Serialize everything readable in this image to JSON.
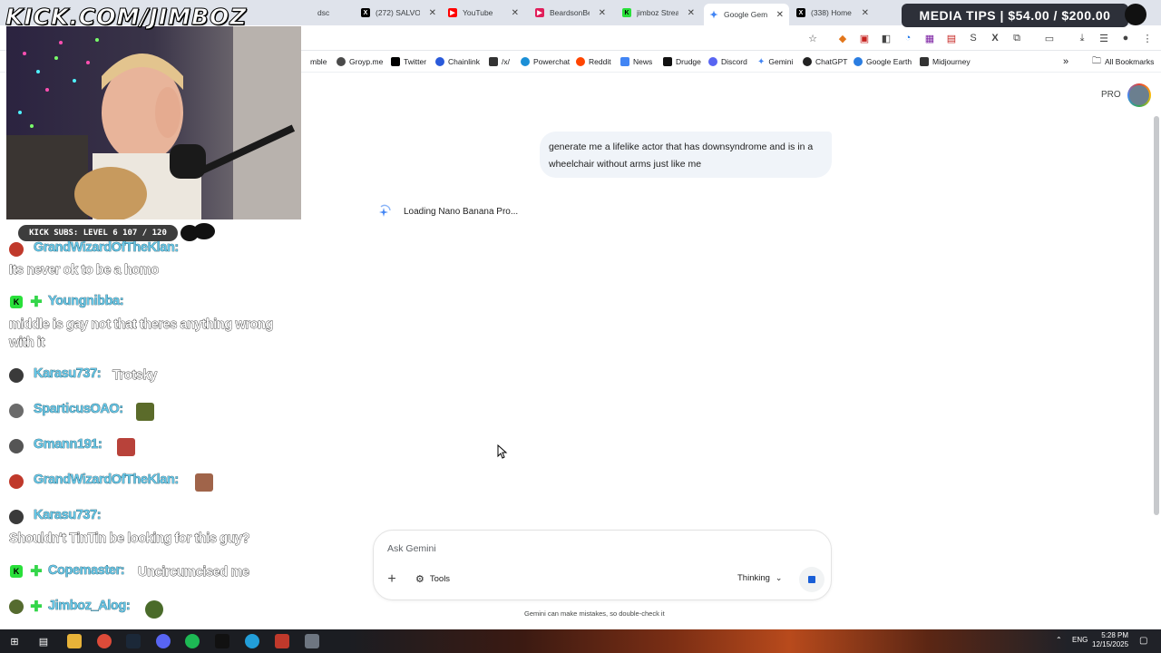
{
  "browser": {
    "tabs": [
      {
        "label": "dsc",
        "color": "#7b6a5a",
        "active": false
      },
      {
        "label": "(272) SALVO",
        "color": "#000000",
        "active": false
      },
      {
        "label": "YouTube",
        "color": "#ff0000",
        "active": false
      },
      {
        "label": "BeardsonBea",
        "color": "#e01e5a",
        "active": false
      },
      {
        "label": "jimboz Stream",
        "color": "#29e03a",
        "active": false
      },
      {
        "label": "Google Gemi",
        "color": "#4285f4",
        "active": true
      },
      {
        "label": "(338) Home",
        "color": "#000000",
        "active": false
      }
    ],
    "bookmarks": [
      {
        "label": "mble",
        "color": "#555555"
      },
      {
        "label": "Groyp.me",
        "color": "#4a4a4a"
      },
      {
        "label": "Twitter",
        "color": "#000000"
      },
      {
        "label": "Chainlink",
        "color": "#2a5ada"
      },
      {
        "label": "/x/",
        "color": "#333333"
      },
      {
        "label": "Powerchat",
        "color": "#1b8fd6"
      },
      {
        "label": "Reddit",
        "color": "#ff4500"
      },
      {
        "label": "News",
        "color": "#4285f4"
      },
      {
        "label": "Drudge",
        "color": "#111111"
      },
      {
        "label": "Discord",
        "color": "#5865f2"
      },
      {
        "label": "Gemini",
        "color": "#4285f4"
      },
      {
        "label": "ChatGPT",
        "color": "#222222"
      },
      {
        "label": "Google Earth",
        "color": "#2a7de1"
      },
      {
        "label": "Midjourney",
        "color": "#333333"
      }
    ],
    "all_bookmarks": "All Bookmarks"
  },
  "overlay": {
    "logo": "KICK.COM/JIMBOZ",
    "media_tips": "MEDIA TIPS | $54.00 / $200.00",
    "subs_bar": "KICK SUBS: LEVEL 6 107 / 120"
  },
  "chat": [
    {
      "user": "GrandWizardOfTheKlan:",
      "text": "Its never ok to be a homo"
    },
    {
      "user": "Youngnibba:",
      "text": "middle is gay not that theres anything wrong with it"
    },
    {
      "user": "Karasu737:",
      "text": "Trotsky"
    },
    {
      "user": "SparticusOAO:",
      "text": ""
    },
    {
      "user": "Gmann191:",
      "text": ""
    },
    {
      "user": "GrandWizardOfTheKlan:",
      "text": ""
    },
    {
      "user": "Karasu737:",
      "text": "Shouldn't TinTin be looking for this guy?"
    },
    {
      "user": "Copemaster:",
      "text": "Uncircumcised me"
    },
    {
      "user": "Jimboz_Alog:",
      "text": ""
    }
  ],
  "gemini": {
    "plan_badge": "PRO",
    "user_prompt": "generate me a lifelike actor that has downsyndrome and is in a wheelchair without arms just like me",
    "loading_text": "Loading Nano Banana Pro...",
    "input_placeholder": "Ask Gemini",
    "tools_label": "Tools",
    "mode_label": "Thinking",
    "disclaimer": "Gemini can make mistakes, so double-check it"
  },
  "taskbar": {
    "lang": "ENG",
    "time": "5:28 PM",
    "date": "12/15/2025"
  },
  "colors": {
    "gemini_blue": "#1a5fd7",
    "chat_username": "#67c6e6",
    "kick_green": "#29e03a"
  }
}
